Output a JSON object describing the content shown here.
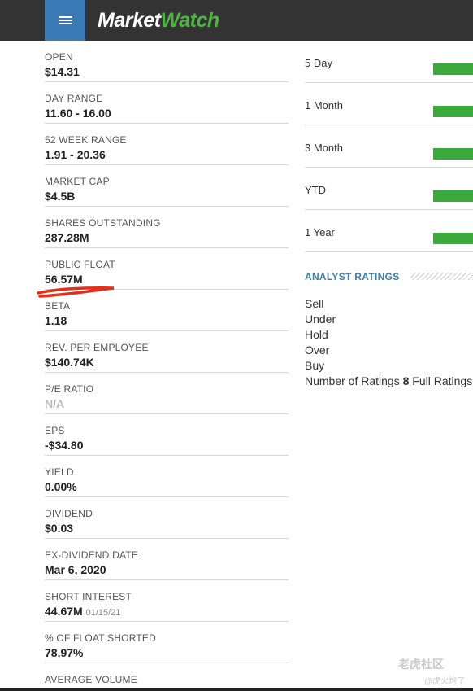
{
  "header": {
    "menu_icon": "hamburger-menu-icon",
    "logo_part1": "Market",
    "logo_part2": "Watch",
    "bg_color": "#333333",
    "menu_color": "#3a7bb5",
    "accent_green": "#4fb443"
  },
  "stats": [
    {
      "label": "OPEN",
      "value": "$14.31"
    },
    {
      "label": "DAY RANGE",
      "value": "11.60 - 16.00"
    },
    {
      "label": "52 WEEK RANGE",
      "value": "1.91 - 20.36"
    },
    {
      "label": "MARKET CAP",
      "value": "$4.5B"
    },
    {
      "label": "SHARES OUTSTANDING",
      "value": "287.28M"
    },
    {
      "label": "PUBLIC FLOAT",
      "value": "56.57M"
    },
    {
      "label": "BETA",
      "value": "1.18"
    },
    {
      "label": "REV. PER EMPLOYEE",
      "value": "$140.74K"
    },
    {
      "label": "P/E RATIO",
      "value": "N/A"
    },
    {
      "label": "EPS",
      "value": "-$34.80"
    },
    {
      "label": "YIELD",
      "value": "0.00%"
    },
    {
      "label": "DIVIDEND",
      "value": "$0.03"
    },
    {
      "label": "EX-DIVIDEND DATE",
      "value": "Mar 6, 2020"
    },
    {
      "label": "SHORT INTEREST",
      "value": "44.67M",
      "sub": "01/15/21"
    },
    {
      "label": "% OF FLOAT SHORTED",
      "value": "78.97%"
    },
    {
      "label": "AVERAGE VOLUME",
      "value": ""
    }
  ],
  "performance": {
    "rows": [
      {
        "label": "5 Day"
      },
      {
        "label": "1 Month"
      },
      {
        "label": "3 Month"
      },
      {
        "label": "YTD"
      },
      {
        "label": "1 Year"
      }
    ],
    "bar_color": "#3aa83a"
  },
  "analyst": {
    "title": "ANALYST RATINGS",
    "title_color": "#3d7fa8",
    "ratings": [
      "Sell",
      "Under",
      "Hold",
      "Over",
      "Buy"
    ],
    "count_label": "Number of Ratings",
    "count_value": "8",
    "full_label": "Full Ratings"
  },
  "annotation": {
    "underline_color": "#e0301e"
  },
  "watermark": {
    "line1": "老虎社区",
    "line2": "@虎火炮了"
  }
}
